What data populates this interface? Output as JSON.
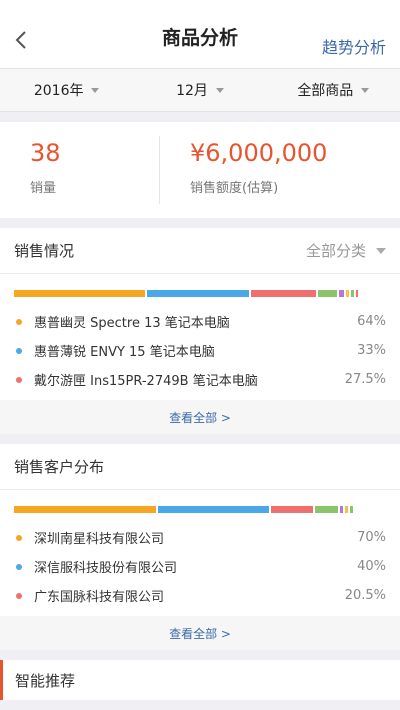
{
  "nav": {
    "title": "商品分析",
    "right_link": "趋势分析"
  },
  "filters": [
    {
      "label": "2016年"
    },
    {
      "label": "12月"
    },
    {
      "label": "全部商品"
    }
  ],
  "stats": {
    "sales_count": {
      "value": "38",
      "label": "销量"
    },
    "sales_amount": {
      "value": "¥6,000,000",
      "label": "销售额度(估算)"
    }
  },
  "sales_situation": {
    "title": "销售情况",
    "filter": "全部分类",
    "bar": [
      {
        "share": 0.367,
        "color": "#f5a623"
      },
      {
        "share": 0.283,
        "color": "#4aa8e8"
      },
      {
        "share": 0.183,
        "color": "#f07070"
      },
      {
        "share": 0.052,
        "color": "#8cc46c"
      },
      {
        "share": 0.015,
        "color": "#b874d8"
      },
      {
        "share": 0.008,
        "color": "#f5c242"
      },
      {
        "share": 0.008,
        "color": "#8cc46c"
      },
      {
        "share": 0.006,
        "color": "#f07070"
      }
    ],
    "items": [
      {
        "name": "惠普幽灵 Spectre 13 笔记本电脑",
        "pct": "64%",
        "color": "#f5a623"
      },
      {
        "name": "惠普薄锐 ENVY 15 笔记本电脑",
        "pct": "33%",
        "color": "#4aa8e8"
      },
      {
        "name": "戴尔游匣 Ins15PR-2749B 笔记本电脑",
        "pct": "27.5%",
        "color": "#f07070"
      }
    ],
    "more": "查看全部 >"
  },
  "customer_distribution": {
    "title": "销售客户分布",
    "bar": [
      {
        "share": 0.395,
        "color": "#f5a623"
      },
      {
        "share": 0.307,
        "color": "#4aa8e8"
      },
      {
        "share": 0.118,
        "color": "#f07070"
      },
      {
        "share": 0.062,
        "color": "#8cc46c"
      },
      {
        "share": 0.01,
        "color": "#b874d8"
      },
      {
        "share": 0.008,
        "color": "#f5c242"
      },
      {
        "share": 0.008,
        "color": "#8cc46c"
      }
    ],
    "items": [
      {
        "name": "深圳南星科技有限公司",
        "pct": "70%",
        "color": "#f5a623"
      },
      {
        "name": "深信服科技股份有限公司",
        "pct": "40%",
        "color": "#4aa8e8"
      },
      {
        "name": "广东国脉科技有限公司",
        "pct": "20.5%",
        "color": "#f07070"
      }
    ],
    "more": "查看全部 >"
  },
  "smart": {
    "title": "智能推荐"
  }
}
